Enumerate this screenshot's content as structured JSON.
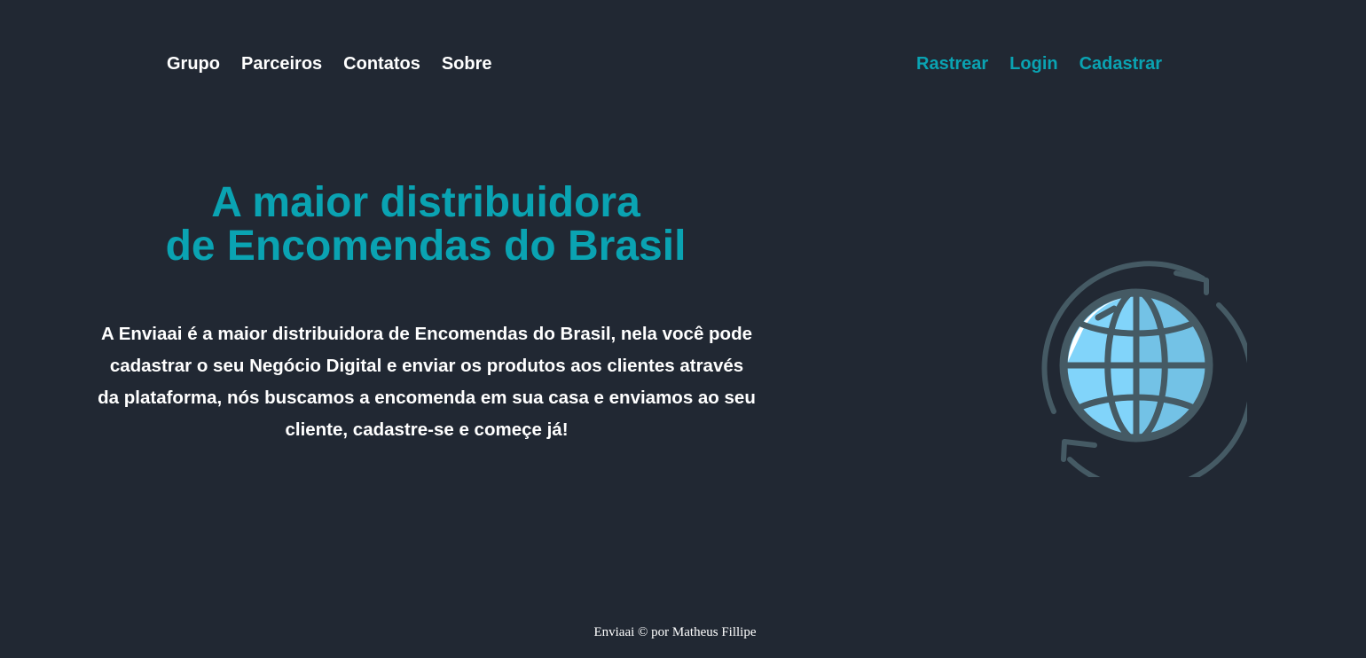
{
  "nav": {
    "left": [
      {
        "label": "Grupo"
      },
      {
        "label": "Parceiros"
      },
      {
        "label": "Contatos"
      },
      {
        "label": "Sobre"
      }
    ],
    "right": [
      {
        "label": "Rastrear"
      },
      {
        "label": "Login"
      },
      {
        "label": "Cadastrar"
      }
    ]
  },
  "hero": {
    "title_line1": "A maior distribuidora",
    "title_line2": "de Encomendas do Brasil",
    "description": "A Enviaai é a maior distribuidora de Encomendas do Brasil, nela você pode cadastrar o seu Negócio Digital e enviar os produtos aos clientes através da plataforma, nós buscamos a encomenda em sua casa e enviamos ao seu cliente, cadastre-se e começe já!",
    "illustration_icon": "globe-sync-icon"
  },
  "footer": {
    "text": "Enviaai © por Matheus Fillipe"
  },
  "colors": {
    "background": "#212833",
    "accent": "#0aa3b2",
    "text": "#ffffff",
    "globe_fill": "#81d4fa",
    "globe_stroke": "#455a64"
  }
}
